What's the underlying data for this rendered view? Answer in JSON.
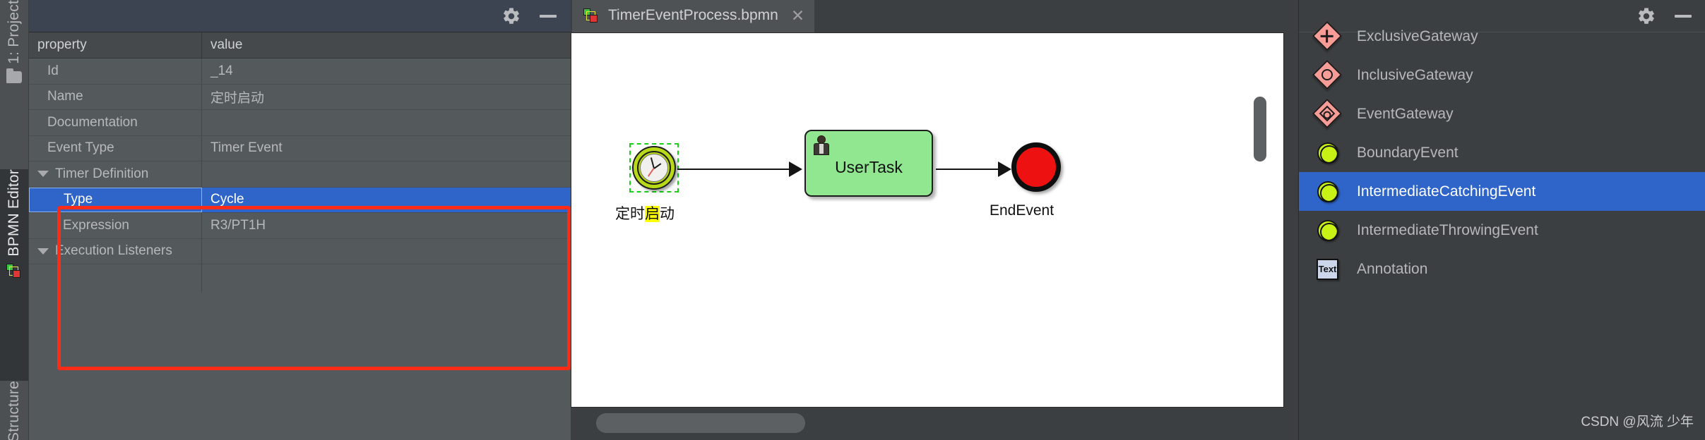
{
  "toolstrip": {
    "items": [
      {
        "label": "1: Project",
        "icon": "folder-icon"
      },
      {
        "label": "BPMN Editor",
        "icon": "bpmn-icon"
      },
      {
        "label": "Structure",
        "icon": "none"
      }
    ]
  },
  "property_panel": {
    "titlebar": {
      "gear_icon": "gear-icon",
      "minimize_icon": "minimize-icon"
    },
    "columns": [
      "property",
      "value"
    ],
    "rows": [
      {
        "property": "Id",
        "value": "_14",
        "indent": 1,
        "expander": false,
        "selected": false
      },
      {
        "property": "Name",
        "value": "定时启动",
        "indent": 1,
        "expander": false,
        "selected": false
      },
      {
        "property": "Documentation",
        "value": "",
        "indent": 1,
        "expander": false,
        "selected": false
      },
      {
        "property": "Event Type",
        "value": "Timer Event",
        "indent": 1,
        "expander": false,
        "selected": false
      },
      {
        "property": "Timer Definition",
        "value": "",
        "indent": 0,
        "expander": true,
        "selected": false
      },
      {
        "property": "Type",
        "value": "Cycle",
        "indent": 2,
        "expander": false,
        "selected": true
      },
      {
        "property": "Expression",
        "value": "R3/PT1H",
        "indent": 2,
        "expander": false,
        "selected": false
      },
      {
        "property": "Execution Listeners",
        "value": "",
        "indent": 0,
        "expander": true,
        "selected": false
      }
    ],
    "highlight_box_color": "#fe2b16",
    "selection_color": "#2f65c8"
  },
  "editor": {
    "tab": {
      "label": "TimerEventProcess.bpmn",
      "close_icon": "✕",
      "file_icon": "bpmn-file-icon"
    },
    "diagram": {
      "start_event": {
        "label_prefix": "定时",
        "label_highlight": "启",
        "label_suffix": "动",
        "icon": "timer-clock-icon",
        "selected": true
      },
      "user_task": {
        "label": "UserTask",
        "icon": "user-icon"
      },
      "end_event": {
        "label": "EndEvent",
        "icon": "end-event-icon"
      }
    },
    "scrollbars": {
      "vertical": "vertical-scrollbar",
      "horizontal": "horizontal-scrollbar"
    }
  },
  "palette": {
    "titlebar": {
      "gear_icon": "gear-icon",
      "minimize_icon": "minimize-icon"
    },
    "items": [
      {
        "label": "ExclusiveGateway",
        "icon": "exclusive-gateway-icon",
        "selected": false
      },
      {
        "label": "InclusiveGateway",
        "icon": "inclusive-gateway-icon",
        "selected": false
      },
      {
        "label": "EventGateway",
        "icon": "event-gateway-icon",
        "selected": false
      },
      {
        "label": "BoundaryEvent",
        "icon": "boundary-event-icon",
        "selected": false
      },
      {
        "label": "IntermediateCatchingEvent",
        "icon": "intermediate-catching-event-icon",
        "selected": true
      },
      {
        "label": "IntermediateThrowingEvent",
        "icon": "intermediate-throwing-event-icon",
        "selected": false
      },
      {
        "label": "Annotation",
        "icon": "text-annotation-icon",
        "selected": false,
        "icon_text": "Text"
      }
    ]
  },
  "watermark": {
    "text": "CSDN @风流 少年"
  }
}
